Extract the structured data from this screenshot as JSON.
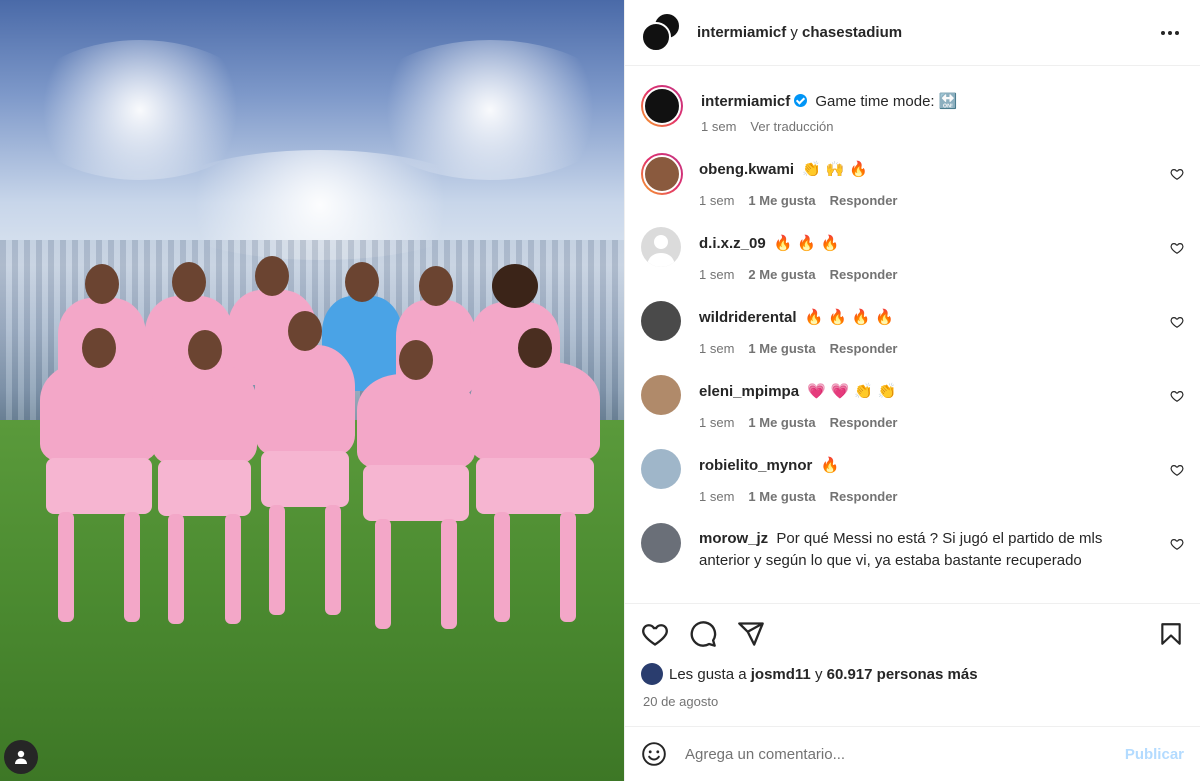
{
  "post": {
    "header_user": "intermiamicf",
    "header_connector": "y",
    "header_location": "chasestadium",
    "caption": {
      "username": "intermiamicf",
      "text": "Game time mode:",
      "emoji": "🔛",
      "time": "1 sem",
      "translate": "Ver traducción"
    },
    "comments": [
      {
        "username": "obeng.kwami",
        "text": "👏 🙌 🔥",
        "time": "1 sem",
        "likes": "1 Me gusta",
        "reply": "Responder",
        "avatar_color": "#8a5a3e"
      },
      {
        "username": "d.i.x.z_09",
        "text": "🔥 🔥 🔥",
        "time": "1 sem",
        "likes": "2 Me gusta",
        "reply": "Responder",
        "avatar_color": "#dbdbdb"
      },
      {
        "username": "wildriderental",
        "text": "🔥 🔥 🔥 🔥",
        "time": "1 sem",
        "likes": "1 Me gusta",
        "reply": "Responder",
        "avatar_color": "#4a4a4a"
      },
      {
        "username": "eleni_mpimpa",
        "text": "💗 💗 👏 👏",
        "time": "1 sem",
        "likes": "1 Me gusta",
        "reply": "Responder",
        "avatar_color": "#b08a6a"
      },
      {
        "username": "robielito_mynor",
        "text": "🔥",
        "time": "1 sem",
        "likes": "1 Me gusta",
        "reply": "Responder",
        "avatar_color": "#9fb6c9"
      },
      {
        "username": "morow_jz",
        "text": "Por qué Messi no está ? Si jugó el partido de mls anterior y según lo que vi, ya estaba bastante recuperado",
        "avatar_color": "#6a6f78"
      }
    ],
    "likes": {
      "prefix": "Les gusta a",
      "user": "josmd11",
      "connector": "y",
      "count": "60.917 personas más"
    },
    "date": "20 de agosto",
    "add_comment": {
      "placeholder": "Agrega un comentario...",
      "publish": "Publicar"
    }
  },
  "icons": {
    "more": "more-icon",
    "heart": "heart-icon",
    "comment": "comment-icon",
    "share": "share-icon",
    "bookmark": "bookmark-icon",
    "emoji": "emoji-icon",
    "user": "user-icon"
  },
  "colors": {
    "verified": "#0095f6",
    "publish": "#b3dbff",
    "secondary_text": "#737373",
    "kit_pink": "#f3a7c8"
  }
}
